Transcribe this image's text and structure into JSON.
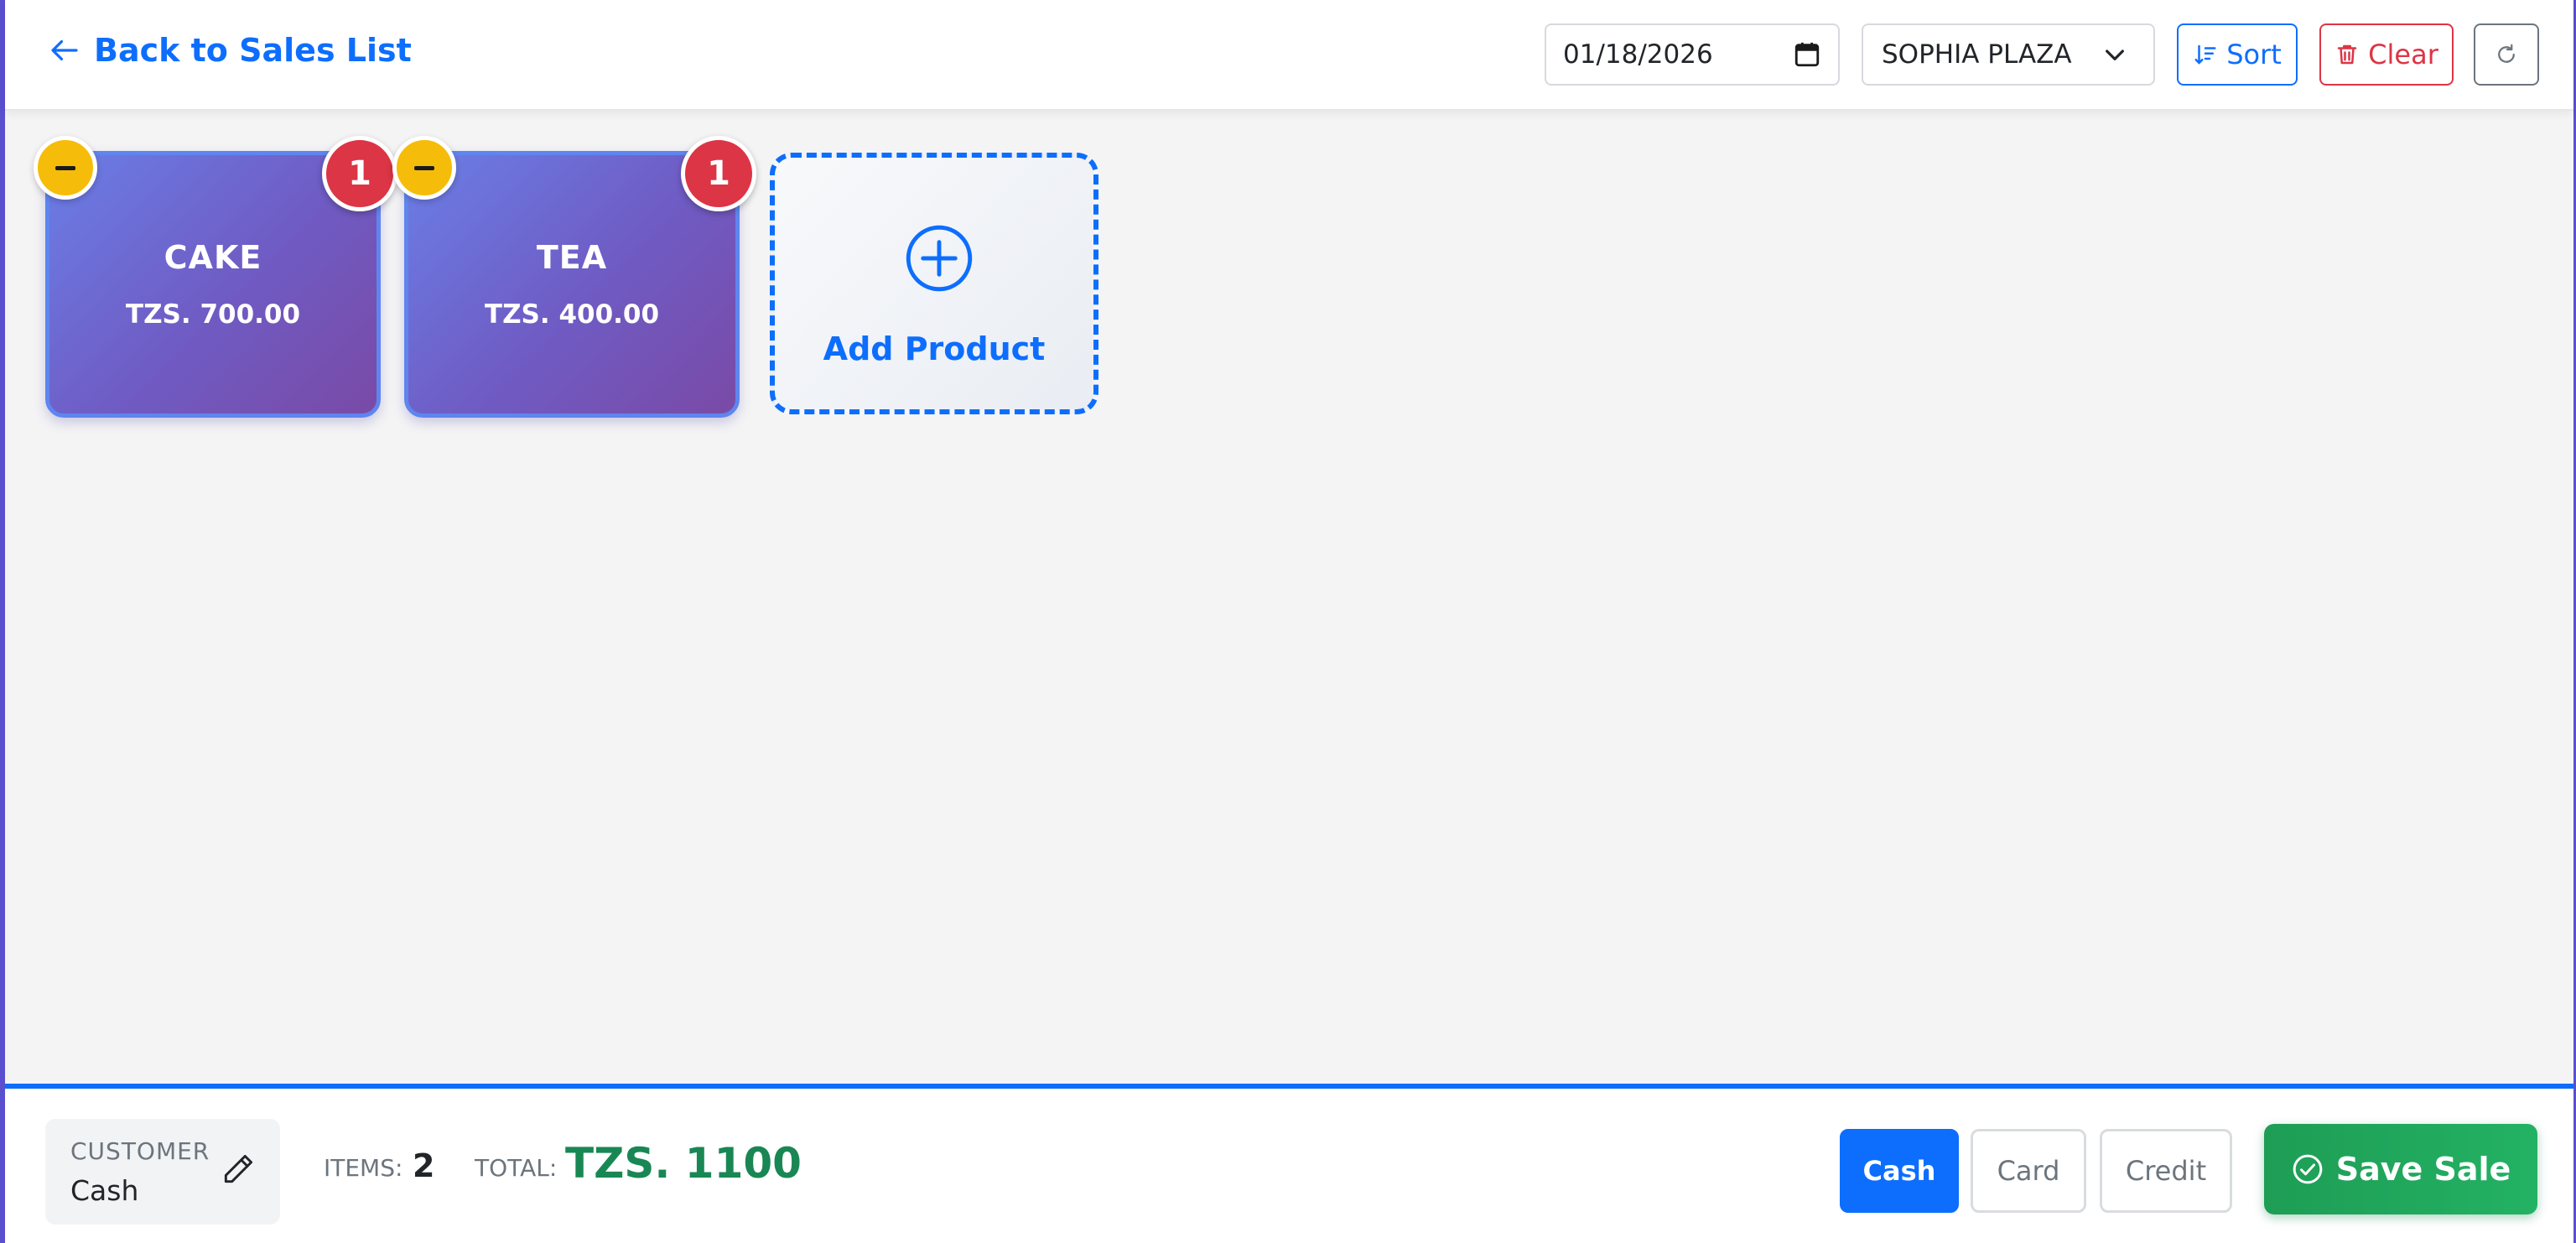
{
  "header": {
    "back_label": "Back to Sales List",
    "date_value": "01/18/2026",
    "location_selected": "SOPHIA PLAZA",
    "sort_label": "Sort",
    "clear_label": "Clear"
  },
  "products": [
    {
      "name": "CAKE",
      "price": "TZS. 700.00",
      "quantity": "1"
    },
    {
      "name": "TEA",
      "price": "TZS. 400.00",
      "quantity": "1"
    }
  ],
  "add_product_label": "Add Product",
  "footer": {
    "customer_label": "CUSTOMER",
    "customer_value": "Cash",
    "items_label": "ITEMS:",
    "items_value": "2",
    "total_label": "TOTAL:",
    "total_value": "TZS. 1100",
    "payment_methods": [
      "Cash",
      "Card",
      "Credit"
    ],
    "selected_payment": "Cash",
    "save_label": "Save Sale"
  },
  "icons": {
    "back": "arrow-left-icon",
    "date": "calendar-icon",
    "select": "chevron-down-icon",
    "sort": "sort-icon",
    "clear": "trash-icon",
    "refresh": "refresh-icon",
    "add": "plus-circle-icon",
    "edit": "pencil-icon",
    "save": "check-circle-icon"
  },
  "colors": {
    "primary": "#0d6efd",
    "danger": "#dc3545",
    "warning": "#f5bd0a",
    "success": "#198754",
    "card_gradient_start": "#6a7ee6",
    "card_gradient_end": "#7a4aa6"
  }
}
